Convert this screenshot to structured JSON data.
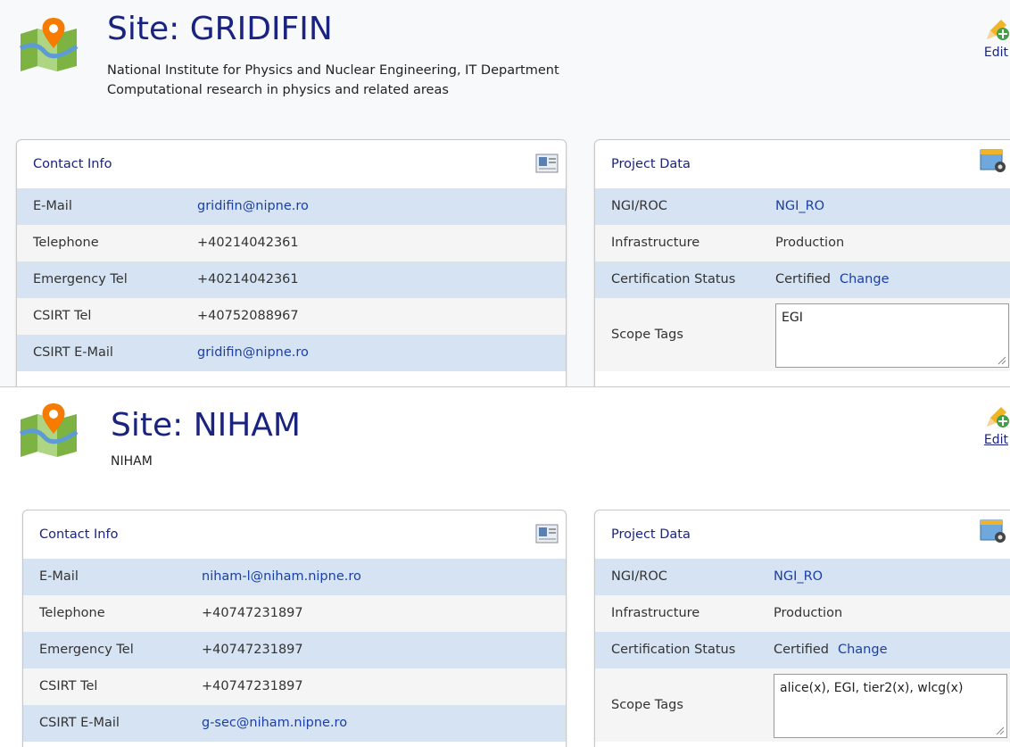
{
  "sites": [
    {
      "title": "Site: GRIDIFIN",
      "description_lines": [
        "National Institute for Physics and Nuclear Engineering, IT Department",
        "Computational research in physics and related areas"
      ],
      "edit_label": "Edit",
      "contact": {
        "header": "Contact Info",
        "rows": [
          {
            "label": "E-Mail",
            "value": "gridifin@nipne.ro"
          },
          {
            "label": "Telephone",
            "value": "+40214042361"
          },
          {
            "label": "Emergency Tel",
            "value": "+40214042361"
          },
          {
            "label": "CSIRT Tel",
            "value": "+40752088967"
          },
          {
            "label": "CSIRT E-Mail",
            "value": "gridifin@nipne.ro"
          }
        ]
      },
      "project": {
        "header": "Project Data",
        "ngi_label": "NGI/ROC",
        "ngi_value": "NGI_RO",
        "infra_label": "Infrastructure",
        "infra_value": "Production",
        "cert_label": "Certification Status",
        "cert_value": "Certified",
        "cert_change": "Change",
        "scope_label": "Scope Tags",
        "scope_value": "EGI"
      }
    },
    {
      "title": "Site: NIHAM",
      "description_lines": [
        "NIHAM"
      ],
      "edit_label": "Edit",
      "contact": {
        "header": "Contact Info",
        "rows": [
          {
            "label": "E-Mail",
            "value": "niham-l@niham.nipne.ro"
          },
          {
            "label": "Telephone",
            "value": "+40747231897"
          },
          {
            "label": "Emergency Tel",
            "value": "+40747231897"
          },
          {
            "label": "CSIRT Tel",
            "value": "+40747231897"
          },
          {
            "label": "CSIRT E-Mail",
            "value": "g-sec@niham.nipne.ro"
          }
        ]
      },
      "project": {
        "header": "Project Data",
        "ngi_label": "NGI/ROC",
        "ngi_value": "NGI_RO",
        "infra_label": "Infrastructure",
        "infra_value": "Production",
        "cert_label": "Certification Status",
        "cert_value": "Certified",
        "cert_change": "Change",
        "scope_label": "Scope Tags",
        "scope_value": "alice(x), EGI, tier2(x), wlcg(x)"
      }
    }
  ],
  "colors": {
    "title": "#1a237e",
    "row_alt": "#d6e3f3",
    "row_plain": "#f5f5f5",
    "link": "#1a3fa6"
  },
  "icons": [
    "map-pin-icon",
    "edit-pencil-icon",
    "contact-card-icon",
    "project-icon",
    "resize-grip-icon"
  ]
}
